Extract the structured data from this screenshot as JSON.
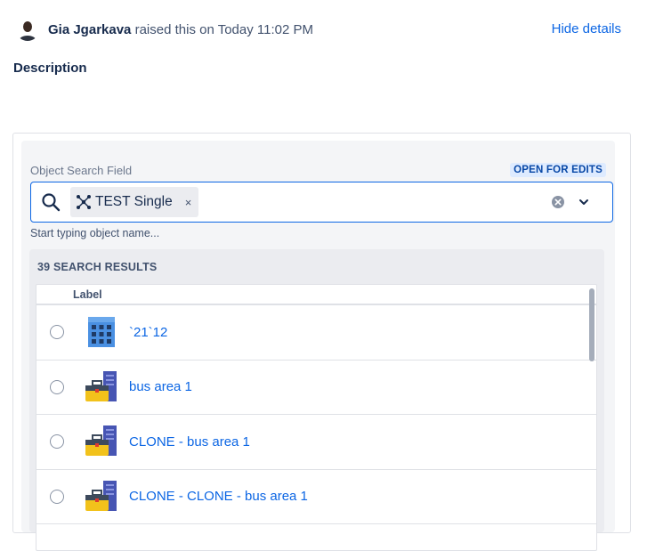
{
  "header": {
    "user_name": "Gia Jgarkava",
    "raised_text": "raised this on Today 11:02 PM",
    "hide_details": "Hide details"
  },
  "description_label": "Description",
  "field": {
    "label": "Object Search Field",
    "badge": "OPEN FOR EDITS",
    "chip_label": "TEST Single",
    "chip_remove": "×",
    "hint": "Start typing object name..."
  },
  "results": {
    "title": "39 SEARCH RESULTS",
    "column_label": "Label",
    "rows": [
      {
        "label": "`21`12",
        "icon": "building-icon"
      },
      {
        "label": "bus area 1",
        "icon": "business-area-icon"
      },
      {
        "label": "CLONE - bus area 1",
        "icon": "business-area-icon"
      },
      {
        "label": "CLONE - CLONE - bus area 1",
        "icon": "business-area-icon"
      }
    ]
  },
  "colors": {
    "accent": "#0c66e4",
    "badge_bg": "#deebff",
    "badge_text": "#0747a6"
  }
}
